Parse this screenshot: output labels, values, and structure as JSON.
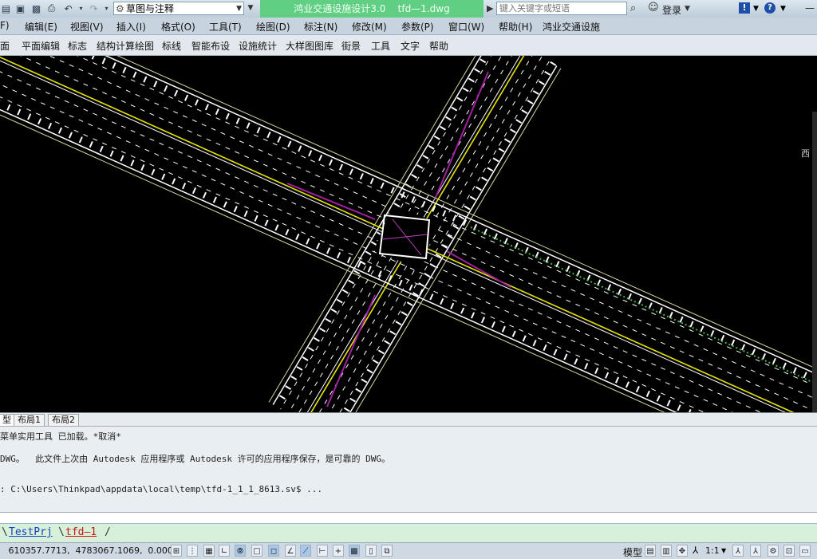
{
  "titlebar": {
    "workspace": "草图与注释",
    "app_title": "鸿业交通设施设计3.0    tfd—1.dwg",
    "search_placeholder": "键入关键字或短语",
    "login": "登录"
  },
  "menu": {
    "items": [
      "F)",
      "编辑(E)",
      "视图(V)",
      "插入(I)",
      "格式(O)",
      "工具(T)",
      "绘图(D)",
      "标注(N)",
      "修改(M)",
      "参数(P)",
      "窗口(W)",
      "帮助(H)",
      "鸿业交通设施"
    ]
  },
  "menu2": {
    "items": [
      "面",
      "平面编辑",
      "标志",
      "结构计算绘图",
      "标线",
      "智能布设",
      "设施统计",
      "大样图图库",
      "街景",
      "工具",
      "文字",
      "帮助"
    ]
  },
  "viewcube": {
    "label": "西"
  },
  "tabs": [
    "型",
    "布局1",
    "布局2"
  ],
  "command": {
    "lines": [
      "菜单实用工具 已加载。*取消*",
      "DWG。  此文件上次由 Autodesk 应用程序或 Autodesk 许可的应用程序保存，是可靠的 DWG。",
      ": C:\\Users\\Thinkpad\\appdata\\local\\temp\\tfd-1_1_1_8613.sv$ ..."
    ]
  },
  "project": {
    "project": "TestPrj",
    "file": "tfd—1"
  },
  "status": {
    "coords": "   610357.7713,  4783067.1069,  0.0000",
    "model": "模型",
    "scale": "1:1"
  },
  "colors": {
    "title_accent": "#61cf83",
    "road_line": "#ffffff",
    "center_line": "#e6e600",
    "lane_marker": "#a020a0",
    "edge_line": "#d8d8a0",
    "green_dots": "#4caf50"
  }
}
